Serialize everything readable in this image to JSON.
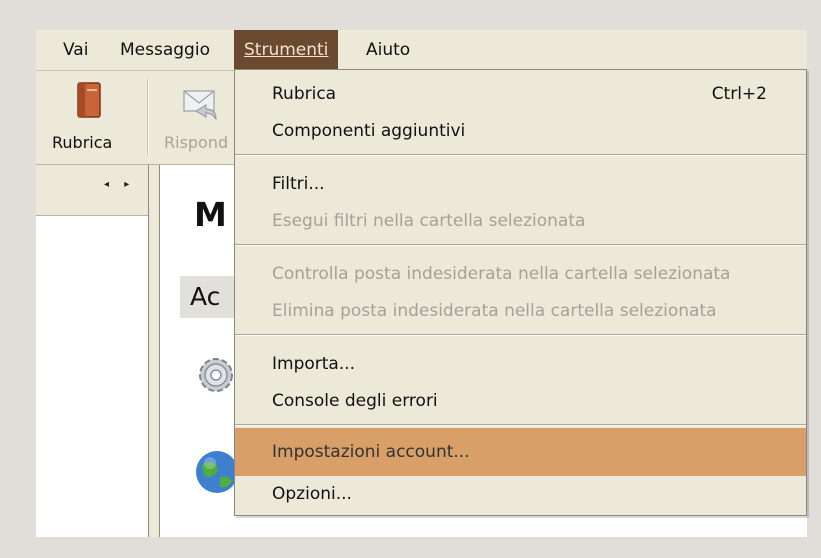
{
  "menubar": {
    "items": [
      {
        "label": "Vai"
      },
      {
        "label": "Messaggio"
      },
      {
        "label": "Strumenti"
      },
      {
        "label": "Aiuto"
      }
    ]
  },
  "toolbar": {
    "rubrica_label": "Rubrica",
    "rispondi_label": "Rispond",
    "rubrica_icon": "address-book-icon",
    "rispondi_icon": "reply-envelope-icon"
  },
  "content": {
    "title": "M",
    "subtitle": "Ac",
    "icons": [
      "gear-icon",
      "globe-icon"
    ]
  },
  "dropdown": {
    "items": [
      {
        "label": "Rubrica",
        "shortcut": "Ctrl+2",
        "enabled": true
      },
      {
        "label": "Componenti aggiuntivi",
        "enabled": true
      },
      {
        "label": "Filtri...",
        "enabled": true
      },
      {
        "label": "Esegui filtri nella cartella selezionata",
        "enabled": false
      },
      {
        "label": "Controlla posta indesiderata nella cartella selezionata",
        "enabled": false
      },
      {
        "label": "Elimina posta indesiderata nella cartella selezionata",
        "enabled": false
      },
      {
        "label": "Importa...",
        "enabled": true
      },
      {
        "label": "Console degli errori",
        "enabled": true
      },
      {
        "label": "Impostazioni account...",
        "enabled": true,
        "highlighted": true
      },
      {
        "label": "Opzioni...",
        "enabled": true
      }
    ]
  },
  "colors": {
    "menu_active_bg": "#6b4a2f",
    "highlight_bg": "#d89f68",
    "disabled_text": "#a5a199"
  }
}
